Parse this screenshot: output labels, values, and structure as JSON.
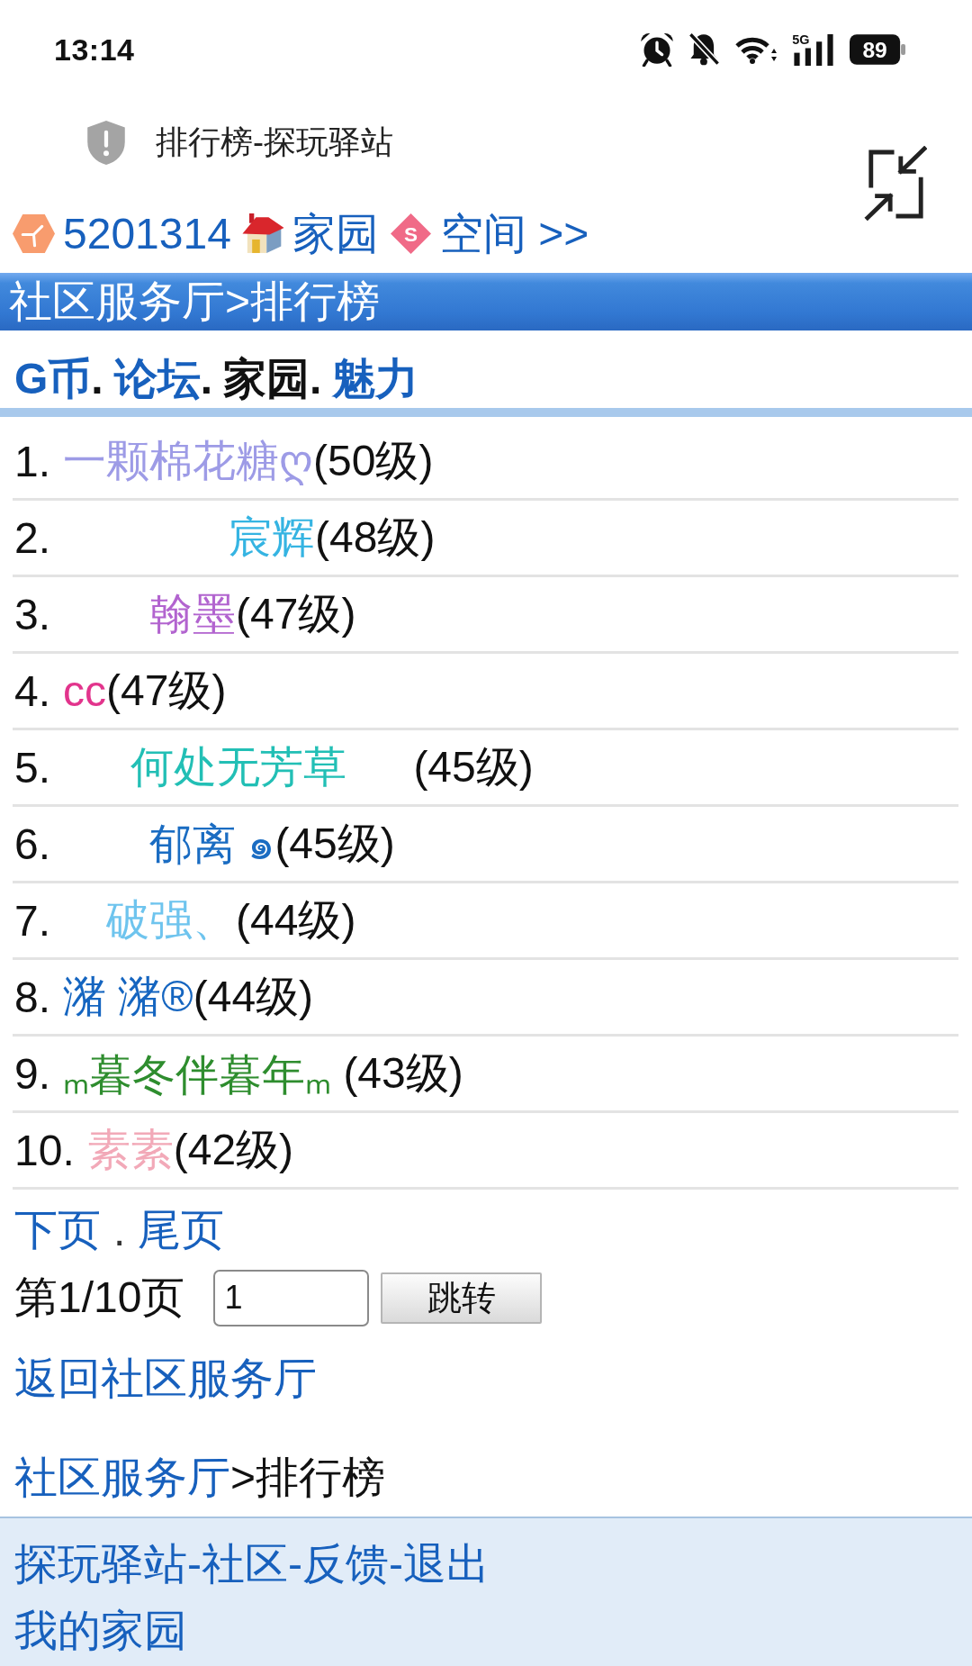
{
  "status_bar": {
    "time": "13:14",
    "network": "5G",
    "battery": "89"
  },
  "browser_bar": {
    "title": "排行榜-探玩驿站"
  },
  "user_nav": [
    {
      "kind": "user",
      "label": "5201314"
    },
    {
      "kind": "home",
      "label": "家园"
    },
    {
      "kind": "space",
      "label": "空间 >>",
      "icon_letter": "S"
    }
  ],
  "header": {
    "breadcrumb": "社区服务厅>排行榜"
  },
  "tabs": [
    {
      "label": "G币",
      "suffix": ".",
      "selected": false
    },
    {
      "label": "论坛",
      "suffix": ".",
      "selected": false
    },
    {
      "label": "家园",
      "suffix": ".",
      "selected": true
    },
    {
      "label": "魅力",
      "selected": false
    }
  ],
  "ranks": [
    {
      "number": "1.",
      "name": "一颗棉花糖ღ",
      "grade": "(50级)",
      "color": "#9d9be6"
    },
    {
      "number": "2.",
      "name": "　　　   宸辉",
      "grade": "(48级)",
      "color": "#35b4e2"
    },
    {
      "number": "3.",
      "name": "　　翰墨",
      "grade": "(47级)",
      "color": "#b264cf"
    },
    {
      "number": "4.",
      "name": "cc",
      "grade": "(47级)",
      "color": "#e2348c"
    },
    {
      "number": "5.",
      "name": "　  何处无芳草　  ",
      "grade": "(45级)",
      "color": "#22bfb5"
    },
    {
      "number": "6.",
      "name": "　　郁离 ๑",
      "grade": "(45级)",
      "color": "#1a6cc2"
    },
    {
      "number": "7.",
      "name": "　破强、",
      "grade": "(44级)",
      "color": "#6ec4ee"
    },
    {
      "number": "8.",
      "name": "潴 潴®",
      "grade": "(44级)",
      "color": "#1565c0"
    },
    {
      "number": "9.",
      "name": "ₘ暮冬伴暮年ₘ ",
      "grade": "(43级)",
      "color": "#2e8d2e"
    },
    {
      "number": "10.",
      "name": "素素",
      "grade": "(42级)",
      "color": "#f2a9b8"
    }
  ],
  "pager": {
    "links": [
      {
        "label": "下页",
        "suffix": "."
      },
      {
        "label": "尾页"
      }
    ],
    "page_info": "第1/10页",
    "page_input": "1",
    "jump_button": "跳转"
  },
  "back_link": "返回社区服务厅",
  "breadcrumb": {
    "link": "社区服务厅",
    "current": ">排行榜"
  },
  "footer": {
    "links": [
      {
        "label": "探玩驿站",
        "suffix": "-"
      },
      {
        "label": "社区",
        "suffix": "-"
      },
      {
        "label": "反馈",
        "suffix": "-"
      },
      {
        "label": "退出"
      }
    ],
    "home_link": "我的家园"
  }
}
